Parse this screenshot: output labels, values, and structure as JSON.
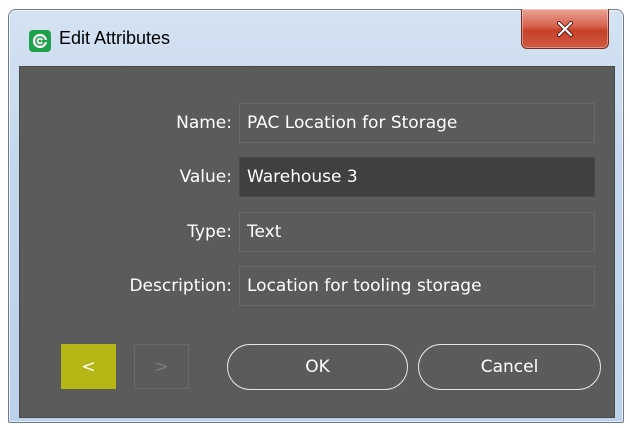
{
  "window": {
    "title": "Edit Attributes",
    "app_icon": "app-logo-icon",
    "close_icon": "close-icon"
  },
  "fields": {
    "name": {
      "label": "Name:",
      "value": "PAC Location for Storage"
    },
    "value": {
      "label": "Value:",
      "value": "Warehouse 3"
    },
    "type": {
      "label": "Type:",
      "value": "Text"
    },
    "description": {
      "label": "Description:",
      "value": "Location for tooling storage"
    }
  },
  "buttons": {
    "prev": "<",
    "next": ">",
    "ok": "OK",
    "cancel": "Cancel"
  },
  "colors": {
    "panel_bg": "#5b5b5b",
    "active_field_bg": "#404040",
    "accent_prev": "#b7b617",
    "close_red": "#c6402a",
    "app_icon_green": "#1fa14b"
  }
}
